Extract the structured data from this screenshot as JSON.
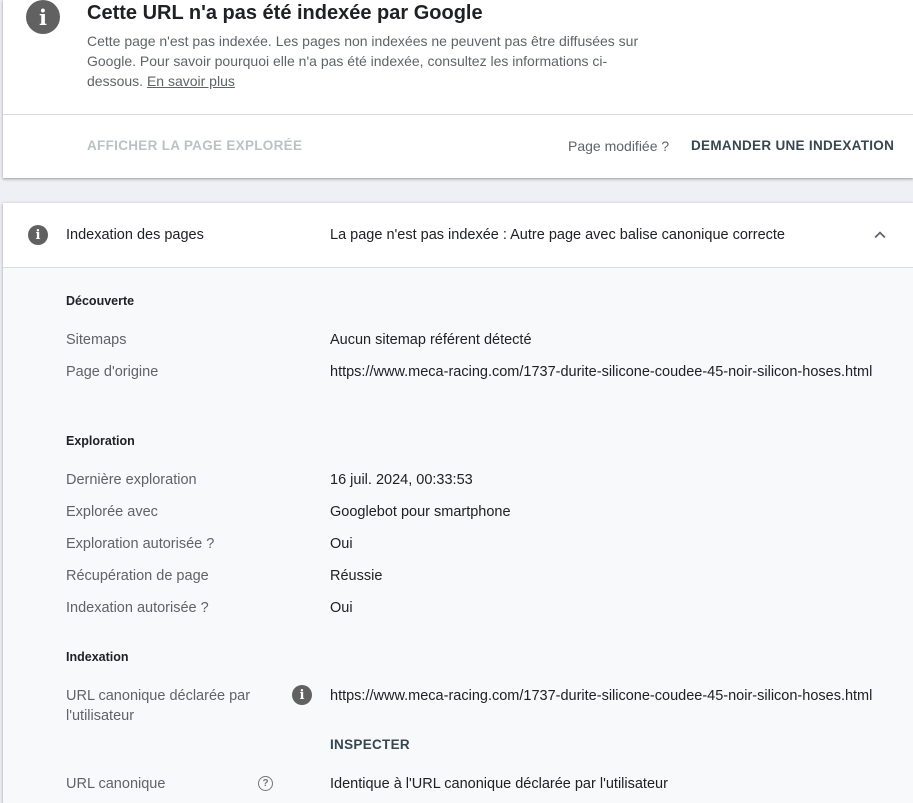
{
  "summary": {
    "title": "Cette URL n'a pas été indexée par Google",
    "description": "Cette page n'est pas indexée. Les pages non indexées ne peuvent pas être diffusées sur Google. Pour savoir pourquoi elle n'a pas été indexée, consultez les informations ci-dessous.",
    "learn_more": "En savoir plus",
    "view_crawled_label": "AFFICHER LA PAGE EXPLORÉE",
    "page_modified_label": "Page modifiée ?",
    "request_indexing_label": "DEMANDER UNE INDEXATION",
    "icon": "info-icon"
  },
  "indexing": {
    "label": "Indexation des pages",
    "status": "La page n'est pas indexée : Autre page avec balise canonique correcte",
    "discovery": {
      "title": "Découverte",
      "sitemaps_label": "Sitemaps",
      "sitemaps_value": "Aucun sitemap référent détecté",
      "referring_page_label": "Page d'origine",
      "referring_page_value": "https://www.meca-racing.com/1737-durite-silicone-coudee-45-noir-silicon-hoses.html"
    },
    "crawl": {
      "title": "Exploration",
      "last_crawl_label": "Dernière exploration",
      "last_crawl_value": "16 juil. 2024, 00:33:53",
      "crawled_as_label": "Explorée avec",
      "crawled_as_value": "Googlebot pour smartphone",
      "crawl_allowed_label": "Exploration autorisée ?",
      "crawl_allowed_value": "Oui",
      "page_fetch_label": "Récupération de page",
      "page_fetch_value": "Réussie",
      "indexing_allowed_label": "Indexation autorisée ?",
      "indexing_allowed_value": "Oui"
    },
    "indexation": {
      "title": "Indexation",
      "user_canonical_label": "URL canonique déclarée par l'utilisateur",
      "user_canonical_value": "https://www.meca-racing.com/1737-durite-silicone-coudee-45-noir-silicon-hoses.html",
      "inspect_label": "INSPECTER",
      "google_canonical_label": "URL canonique",
      "google_canonical_value": "Identique à l'URL canonique déclarée par l'utilisateur"
    }
  }
}
